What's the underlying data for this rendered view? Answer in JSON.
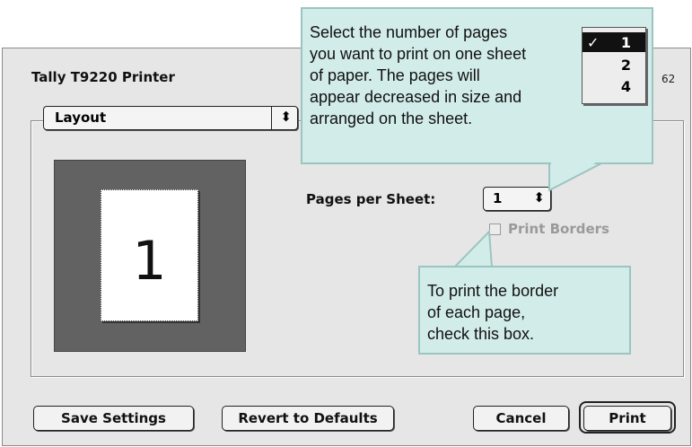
{
  "dialog": {
    "printer_name": "Tally T9220 Printer",
    "version_tail": "62",
    "panel_popup": "Layout",
    "preview_number": "1",
    "pages_per_sheet_label": "Pages per Sheet:",
    "pages_per_sheet_value": "1",
    "print_borders_label": "Print Borders",
    "print_borders_checked": false,
    "print_borders_enabled": false
  },
  "buttons": {
    "save_settings": "Save Settings",
    "revert": "Revert to Defaults",
    "cancel": "Cancel",
    "print": "Print"
  },
  "callouts": {
    "pages_lines": [
      "Select the number of pages",
      "you want to print on one sheet",
      "of paper. The pages will",
      "appear decreased in size and",
      "arranged on the sheet."
    ],
    "borders_lines": [
      "To print the border",
      "of each page,",
      "check this box."
    ]
  },
  "menu": {
    "check_mark": "✓",
    "options": [
      "1",
      "2",
      "4"
    ],
    "selected": "1"
  },
  "icons": {
    "popup_arrows": "updown-arrows-icon",
    "check": "check-icon"
  },
  "colors": {
    "callout_fill": "#d2ecea",
    "callout_border": "#9bc5c1",
    "preview_background": "#626262",
    "dialog_background": "#e6e6e6"
  }
}
